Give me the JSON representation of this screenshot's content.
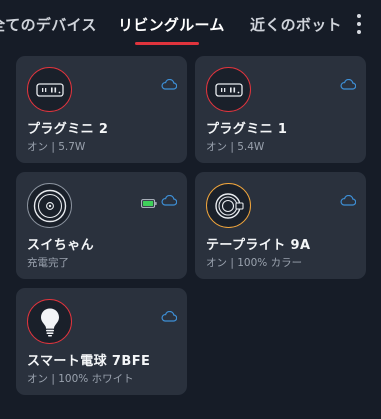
{
  "tabs": [
    {
      "label": "全てのデバイス"
    },
    {
      "label": "リビングルーム"
    },
    {
      "label": "近くのボット"
    }
  ],
  "active_tab": "リビングルーム",
  "accent_color": "#e0343d",
  "devices": [
    {
      "name": "プラグミニ 2",
      "status": "オン | 5.7W",
      "icon": "smart-plug-icon",
      "ring": "red"
    },
    {
      "name": "プラグミニ 1",
      "status": "オン | 5.4W",
      "icon": "smart-plug-icon",
      "ring": "red"
    },
    {
      "name": "スイちゃん",
      "status": "充電完了",
      "icon": "robot-vacuum-icon",
      "ring": "gray",
      "battery": "full"
    },
    {
      "name": "テープライト 9A",
      "status": "オン | 100% カラー",
      "icon": "light-strip-icon",
      "ring": "amber"
    },
    {
      "name": "スマート電球 7BFE",
      "status": "オン | 100% ホワイト",
      "icon": "light-bulb-icon",
      "ring": "red"
    }
  ]
}
